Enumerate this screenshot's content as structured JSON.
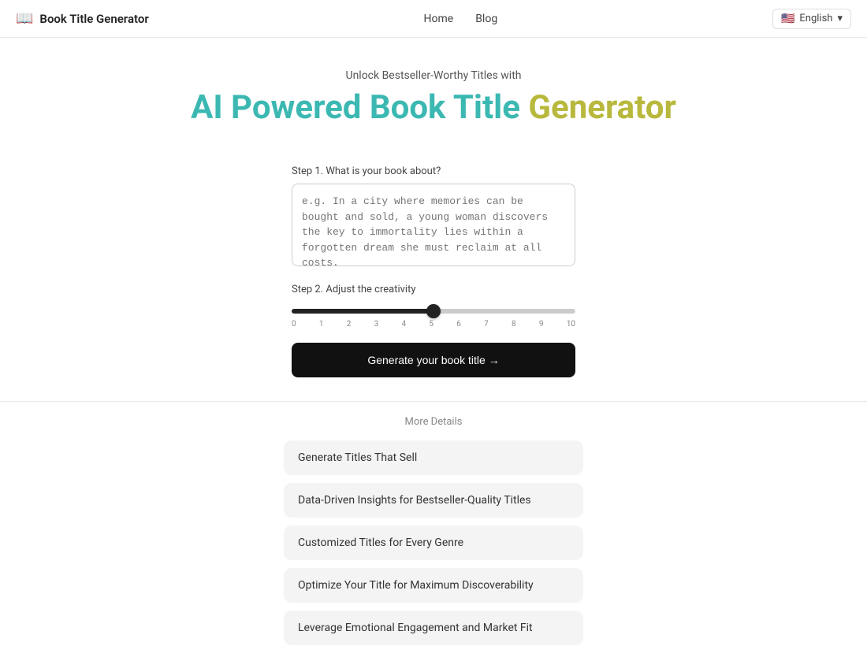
{
  "app": {
    "title": "Book Title Generator",
    "icon": "📖"
  },
  "navbar": {
    "links": [
      {
        "label": "Home",
        "href": "#"
      },
      {
        "label": "Blog",
        "href": "#"
      }
    ],
    "language": {
      "flag": "🇺🇸",
      "label": "English",
      "chevron": "▾"
    }
  },
  "hero": {
    "subtitle": "Unlock Bestseller-Worthy Titles with",
    "title_part1": "AI Powered Book Title ",
    "title_part2": "Generator",
    "title_full": "AI Powered Book Title Generator"
  },
  "form": {
    "step1_label": "Step 1. What is your book about?",
    "step1_placeholder": "e.g. In a city where memories can be bought and sold, a young woman discovers the key to immortality lies within a forgotten dream she must reclaim at all costs.",
    "step2_label": "Step 2. Adjust the creativity",
    "slider_value": 5,
    "slider_min": 0,
    "slider_max": 10,
    "slider_ticks": [
      "0",
      "1",
      "2",
      "3",
      "4",
      "5",
      "6",
      "7",
      "8",
      "9",
      "10"
    ],
    "generate_button": "Generate your book title →"
  },
  "more_details": {
    "section_label": "More Details",
    "features": [
      {
        "label": "Generate Titles That Sell"
      },
      {
        "label": "Data-Driven Insights for Bestseller-Quality Titles"
      },
      {
        "label": "Customized Titles for Every Genre"
      },
      {
        "label": "Optimize Your Title for Maximum Discoverability"
      },
      {
        "label": "Leverage Emotional Engagement and Market Fit"
      }
    ]
  }
}
